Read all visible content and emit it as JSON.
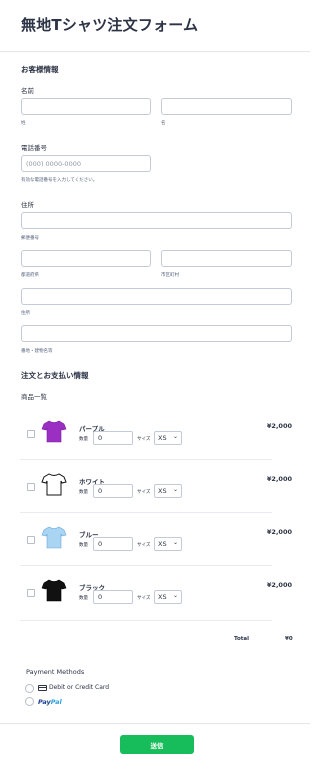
{
  "form": {
    "title": "無地Tシャツ注文フォーム"
  },
  "customer": {
    "section_title": "お客様情報",
    "name_label": "名前",
    "last_name_sub": "姓",
    "first_name_sub": "名",
    "phone_label": "電話番号",
    "phone_placeholder": "(000) 0000-0000",
    "phone_hint": "有効な電話番号を入力してください。",
    "address_label": "住所",
    "postal_sub": "郵便番号",
    "prefecture_sub": "都道府県",
    "city_sub": "市区町村",
    "street_sub": "住所",
    "building_sub": "番地・建物名等"
  },
  "order": {
    "section_title": "注文とお支払い情報",
    "products_label": "商品一覧",
    "qty_label": "数量",
    "size_label": "サイズ",
    "products": [
      {
        "name": "パープル",
        "price": "¥2,000",
        "qty": "0",
        "size": "XS",
        "color": "#9b2fc4",
        "icon": "purple-tshirt-icon"
      },
      {
        "name": "ホワイト",
        "price": "¥2,000",
        "qty": "0",
        "size": "XS",
        "color": "#ffffff",
        "icon": "white-tshirt-icon"
      },
      {
        "name": "ブルー",
        "price": "¥2,000",
        "qty": "0",
        "size": "XS",
        "color": "#a9d4f2",
        "icon": "blue-tshirt-icon"
      },
      {
        "name": "ブラック",
        "price": "¥2,000",
        "qty": "0",
        "size": "XS",
        "color": "#111111",
        "icon": "black-tshirt-icon"
      }
    ],
    "total_label": "Total",
    "total_value": "¥0"
  },
  "payment": {
    "title": "Payment Methods",
    "card_label": "Debit or Credit Card",
    "paypal_pay": "Pay",
    "paypal_pal": "Pal"
  },
  "submit_label": "送信",
  "colors": {
    "accent": "#18bd5b",
    "text": "#2c3345",
    "border": "#c3cad8"
  }
}
